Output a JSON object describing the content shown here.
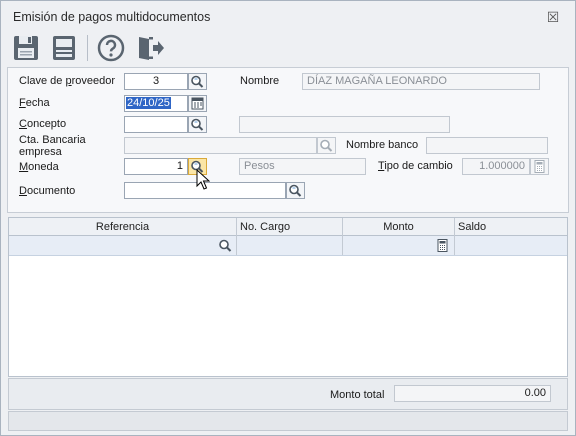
{
  "window": {
    "title": "Emisión de pagos multidocumentos",
    "close_glyph": "☒"
  },
  "toolbar": {
    "buttons": [
      {
        "name": "save-icon",
        "tooltip": ""
      },
      {
        "name": "print-icon",
        "tooltip": ""
      },
      {
        "name": "help-icon",
        "tooltip": ""
      },
      {
        "name": "exit-icon",
        "tooltip": ""
      }
    ]
  },
  "form": {
    "proveedor": {
      "label_pre": "Clave de ",
      "label_u": "p",
      "label_post": "roveedor",
      "value": "3"
    },
    "nombre": {
      "label": "Nombre",
      "value": "DÍAZ MAGAÑA LEONARDO"
    },
    "fecha": {
      "label_u": "F",
      "label_post": "echa",
      "value": "24/10/25"
    },
    "concepto": {
      "label_u": "C",
      "label_post": "oncepto",
      "value": "",
      "desc": ""
    },
    "cta_bancaria": {
      "label_line1": "Cta. Bancaria",
      "label_line2": "empresa",
      "value": ""
    },
    "nombre_banco": {
      "label": "Nombre banco",
      "value": ""
    },
    "moneda": {
      "label_u": "M",
      "label_post": "oneda",
      "value": "1",
      "desc": "Pesos"
    },
    "tipo_cambio": {
      "label_u": "T",
      "label_post": "ipo de cambio",
      "value": "1.000000"
    },
    "documento": {
      "label_u": "D",
      "label_post": "ocumento",
      "value": ""
    }
  },
  "grid": {
    "columns": [
      "Referencia",
      "No. Cargo",
      "Monto",
      "Saldo"
    ],
    "rows": []
  },
  "footer": {
    "monto_total_label": "Monto total",
    "monto_total_value": "0.00"
  },
  "colors": {
    "accent": "#2f66c6",
    "lookup_highlight": "#fbe6a6",
    "window_bg": "#eef0f3"
  }
}
